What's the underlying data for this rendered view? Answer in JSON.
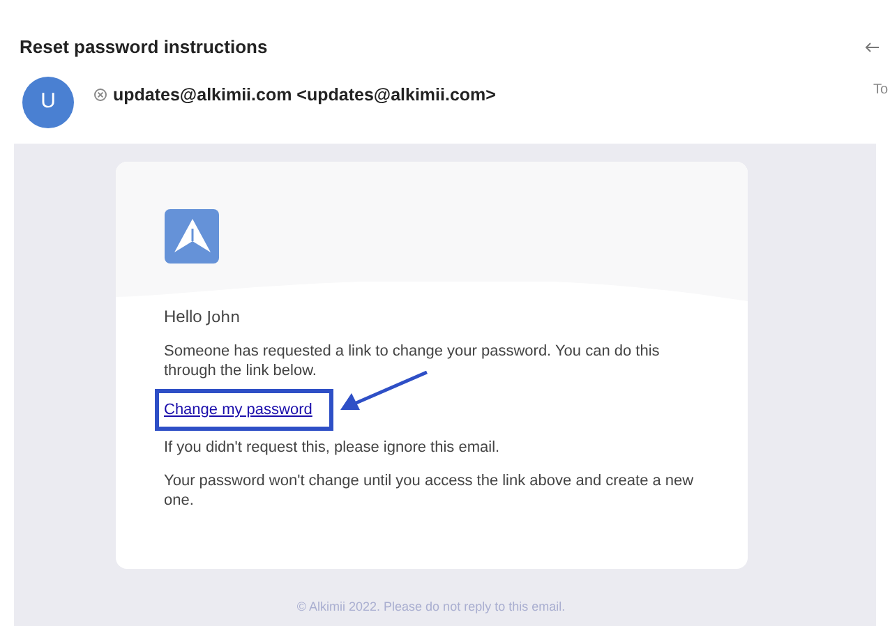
{
  "email": {
    "subject": "Reset password instructions",
    "avatar_letter": "U",
    "sender": "updates@alkimii.com <updates@alkimii.com>",
    "to_label": "To"
  },
  "message": {
    "greeting": "Hello",
    "name": "John",
    "intro": "Someone has requested a link to change your password. You can do this through the link below.",
    "link": "Change my password",
    "ignore": "If you didn't request this, please ignore this email.",
    "note": "Your password won't change until you access the link above and create a new one.",
    "footer": "© Alkimii 2022. Please do not reply to this email."
  }
}
